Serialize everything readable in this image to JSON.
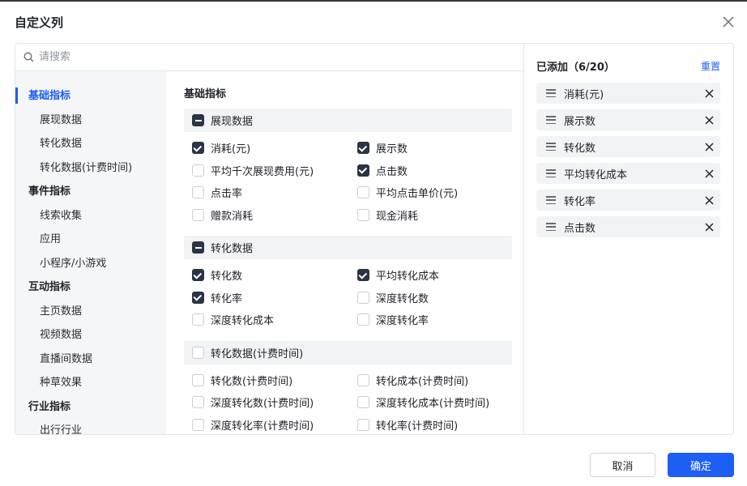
{
  "dialog": {
    "title": "自定义列"
  },
  "search": {
    "placeholder": "请搜索"
  },
  "nav": {
    "categories": [
      {
        "label": "基础指标",
        "active": true,
        "items": [
          "展现数据",
          "转化数据",
          "转化数据(计费时间)"
        ]
      },
      {
        "label": "事件指标",
        "items": [
          "线索收集",
          "应用",
          "小程序/小游戏"
        ]
      },
      {
        "label": "互动指标",
        "items": [
          "主页数据",
          "视频数据",
          "直播间数据",
          "种草效果"
        ]
      },
      {
        "label": "行业指标",
        "items": [
          "出行行业"
        ]
      }
    ]
  },
  "content": {
    "title": "基础指标",
    "groups": [
      {
        "label": "展现数据",
        "state": "partial",
        "options": [
          {
            "label": "消耗(元)",
            "checked": true
          },
          {
            "label": "展示数",
            "checked": true
          },
          {
            "label": "平均千次展现费用(元)",
            "checked": false
          },
          {
            "label": "点击数",
            "checked": true
          },
          {
            "label": "点击率",
            "checked": false
          },
          {
            "label": "平均点击单价(元)",
            "checked": false
          },
          {
            "label": "赠款消耗",
            "checked": false
          },
          {
            "label": "现金消耗",
            "checked": false
          }
        ]
      },
      {
        "label": "转化数据",
        "state": "partial",
        "options": [
          {
            "label": "转化数",
            "checked": true
          },
          {
            "label": "平均转化成本",
            "checked": true
          },
          {
            "label": "转化率",
            "checked": true
          },
          {
            "label": "深度转化数",
            "checked": false
          },
          {
            "label": "深度转化成本",
            "checked": false
          },
          {
            "label": "深度转化率",
            "checked": false
          }
        ]
      },
      {
        "label": "转化数据(计费时间)",
        "state": "none",
        "options": [
          {
            "label": "转化数(计费时间)",
            "checked": false
          },
          {
            "label": "转化成本(计费时间)",
            "checked": false
          },
          {
            "label": "深度转化数(计费时间)",
            "checked": false
          },
          {
            "label": "深度转化成本(计费时间)",
            "checked": false
          },
          {
            "label": "深度转化率(计费时间)",
            "checked": false
          },
          {
            "label": "转化率(计费时间)",
            "checked": false
          }
        ]
      }
    ]
  },
  "added": {
    "title": "已添加（6/20）",
    "reset_label": "重置",
    "items": [
      "消耗(元)",
      "展示数",
      "转化数",
      "平均转化成本",
      "转化率",
      "点击数"
    ]
  },
  "footer": {
    "cancel_label": "取消",
    "ok_label": "确定"
  },
  "colors": {
    "accent": "#1d5ef5",
    "checkbox_checked": "#2b3445"
  }
}
